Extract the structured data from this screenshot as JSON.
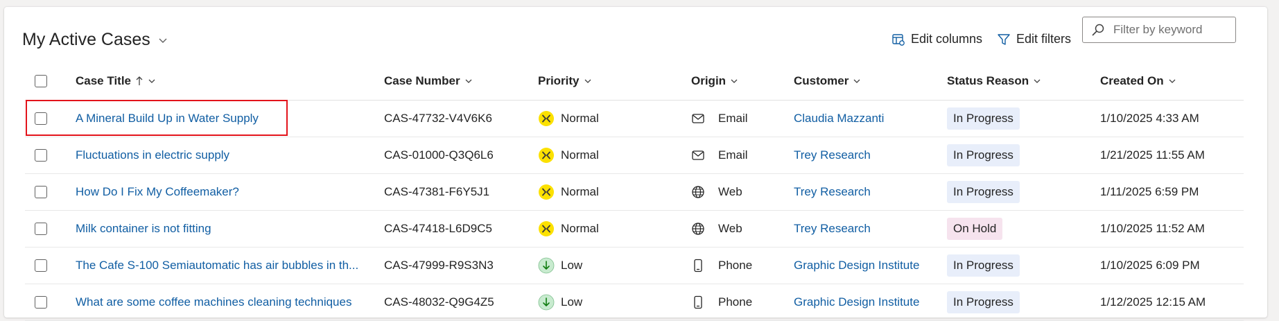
{
  "view": {
    "title": "My Active Cases",
    "edit_columns_label": "Edit columns",
    "edit_filters_label": "Edit filters",
    "search_placeholder": "Filter by keyword"
  },
  "columns": {
    "title": "Case Title",
    "number": "Case Number",
    "priority": "Priority",
    "origin": "Origin",
    "customer": "Customer",
    "status": "Status Reason",
    "created": "Created On"
  },
  "rows": [
    {
      "title": "A Mineral Build Up in Water Supply",
      "number": "CAS-47732-V4V6K6",
      "priority": "Normal",
      "origin": "Email",
      "customer": "Claudia Mazzanti",
      "status": "In Progress",
      "created": "1/10/2025 4:33 AM"
    },
    {
      "title": "Fluctuations in electric supply",
      "number": "CAS-01000-Q3Q6L6",
      "priority": "Normal",
      "origin": "Email",
      "customer": "Trey Research",
      "status": "In Progress",
      "created": "1/21/2025 11:55 AM"
    },
    {
      "title": "How Do I Fix My Coffeemaker?",
      "number": "CAS-47381-F6Y5J1",
      "priority": "Normal",
      "origin": "Web",
      "customer": "Trey Research",
      "status": "In Progress",
      "created": "1/11/2025 6:59 PM"
    },
    {
      "title": "Milk container is not fitting",
      "number": "CAS-47418-L6D9C5",
      "priority": "Normal",
      "origin": "Web",
      "customer": "Trey Research",
      "status": "On Hold",
      "created": "1/10/2025 11:52 AM"
    },
    {
      "title": "The Cafe S-100 Semiautomatic has air bubbles in th...",
      "number": "CAS-47999-R9S3N3",
      "priority": "Low",
      "origin": "Phone",
      "customer": "Graphic Design Institute",
      "status": "In Progress",
      "created": "1/10/2025 6:09 PM"
    },
    {
      "title": "What are some coffee machines cleaning techniques",
      "number": "CAS-48032-Q9G4Z5",
      "priority": "Low",
      "origin": "Phone",
      "customer": "Graphic Design Institute",
      "status": "In Progress",
      "created": "1/12/2025 12:15 AM"
    }
  ],
  "colors": {
    "link": "#115ea3",
    "in_progress_bg": "#e8eefa",
    "on_hold_bg": "#f6e3ee",
    "normal_priority": "#fce100",
    "low_priority": "#c8ebcf",
    "highlight": "#e3131b"
  },
  "icons": {
    "priority": {
      "Normal": "normal-priority-icon",
      "Low": "low-priority-icon"
    },
    "origin": {
      "Email": "email-icon",
      "Web": "globe-icon",
      "Phone": "phone-icon"
    }
  }
}
